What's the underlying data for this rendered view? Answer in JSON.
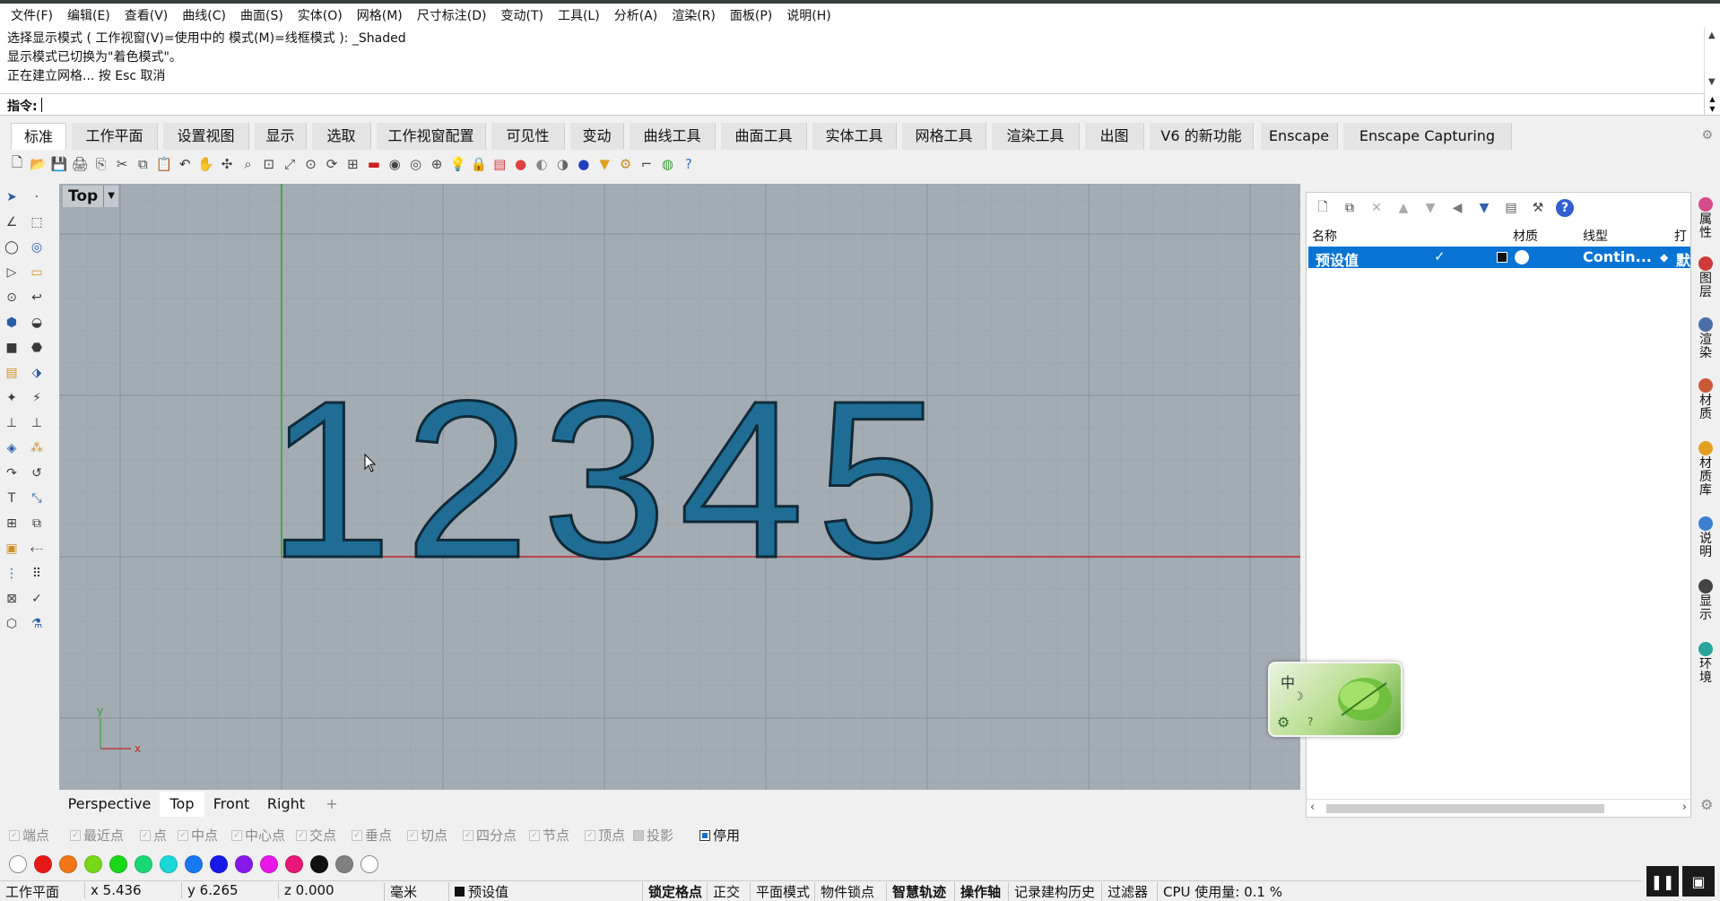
{
  "menu": [
    "文件(F)",
    "编辑(E)",
    "查看(V)",
    "曲线(C)",
    "曲面(S)",
    "实体(O)",
    "网格(M)",
    "尺寸标注(D)",
    "变动(T)",
    "工具(L)",
    "分析(A)",
    "渲染(R)",
    "面板(P)",
    "说明(H)"
  ],
  "command_history": {
    "lines": [
      "选择显示模式 ( 工作视窗(V)=使用中的  模式(M)=线框模式 ): _Shaded",
      "显示模式已切换为\"着色模式\"。",
      "正在建立网格... 按 Esc 取消"
    ]
  },
  "command_prompt": "指令:",
  "tabs": [
    "标准",
    "工作平面",
    "设置视图",
    "显示",
    "选取",
    "工作视窗配置",
    "可见性",
    "变动",
    "曲线工具",
    "曲面工具",
    "实体工具",
    "网格工具",
    "渲染工具",
    "出图",
    "V6 的新功能",
    "Enscape",
    "Enscape Capturing"
  ],
  "toolbar_icons": [
    "new-icon",
    "open-icon",
    "save-icon",
    "print-icon",
    "export-icon",
    "cut-icon",
    "copy-icon",
    "paste-icon",
    "undo-icon",
    "pan-icon",
    "rotate-view-icon",
    "zoom-icon",
    "zoom-window-icon",
    "zoom-extents-icon",
    "zoom-selected-icon",
    "rotate-icon",
    "four-views-icon",
    "car-icon",
    "camera-icon",
    "circle-icon",
    "named-views-icon",
    "light-icon",
    "lock-icon",
    "layer-icon",
    "color-wheel-icon",
    "shaded-sphere-icon",
    "render-sphere-icon",
    "blue-sphere-icon",
    "filter-icon",
    "settings-gear-icon",
    "snap-icon",
    "world-icon",
    "help-icon"
  ],
  "viewport": {
    "name": "Top",
    "digits": "12345"
  },
  "viewport_tabs": [
    "Perspective",
    "Top",
    "Front",
    "Right",
    "+"
  ],
  "layer_panel": {
    "headers": {
      "name": "名称",
      "material": "材质",
      "linetype": "线型",
      "print": "打"
    },
    "row": {
      "name": "预设值",
      "linetype": "Contin...",
      "print": "默"
    }
  },
  "side_tabs": [
    {
      "label": "属性",
      "color": "#d84b8a"
    },
    {
      "label": "图层",
      "color": "#d03a3a"
    },
    {
      "label": "渲染",
      "color": "#4a6ea8"
    },
    {
      "label": "材质",
      "color": "#c85a3a"
    },
    {
      "label": "材质库",
      "color": "#e3a020"
    },
    {
      "label": "说明",
      "color": "#3a7fd0"
    },
    {
      "label": "显示",
      "color": "#444444"
    },
    {
      "label": "环境",
      "color": "#2aa39a"
    }
  ],
  "ime": {
    "mode": "中",
    "moon": "☽",
    "help": "?"
  },
  "osnaps": [
    {
      "label": "端点",
      "state": "off"
    },
    {
      "label": "最近点",
      "state": "off"
    },
    {
      "label": "点",
      "state": "off"
    },
    {
      "label": "中点",
      "state": "off"
    },
    {
      "label": "中心点",
      "state": "off"
    },
    {
      "label": "交点",
      "state": "off"
    },
    {
      "label": "垂点",
      "state": "off"
    },
    {
      "label": "切点",
      "state": "off"
    },
    {
      "label": "四分点",
      "state": "off"
    },
    {
      "label": "节点",
      "state": "off"
    },
    {
      "label": "顶点",
      "state": "off"
    },
    {
      "label": "投影",
      "state": "gray"
    },
    {
      "label": "停用",
      "state": "on"
    }
  ],
  "swatch_colors": [
    "#ffffff",
    "#e81818",
    "#f07818",
    "#78d818",
    "#18d818",
    "#18d878",
    "#18d8d8",
    "#1878f0",
    "#1818e8",
    "#8818e8",
    "#e818e8",
    "#e81878",
    "#111111",
    "#808080",
    "#ffffff"
  ],
  "status": {
    "cplane": "工作平面",
    "x": "x 5.436",
    "y": "y 6.265",
    "z": "z 0.000",
    "units": "毫米",
    "layer": "预设值",
    "toggles": [
      "锁定格点",
      "正交",
      "平面模式",
      "物件锁点",
      "智慧轨迹",
      "操作轴",
      "记录建构历史",
      "过滤器"
    ],
    "bold_toggles": [
      "锁定格点",
      "智慧轨迹",
      "操作轴"
    ],
    "cpu": "CPU 使用量: 0.1 %"
  },
  "colors": {
    "viewport_bg": "#a3abb3",
    "digit_fill": "#1f6d95",
    "x_axis": "#c0262a",
    "y_axis": "#2fa83a",
    "selection": "#0a74d4"
  }
}
